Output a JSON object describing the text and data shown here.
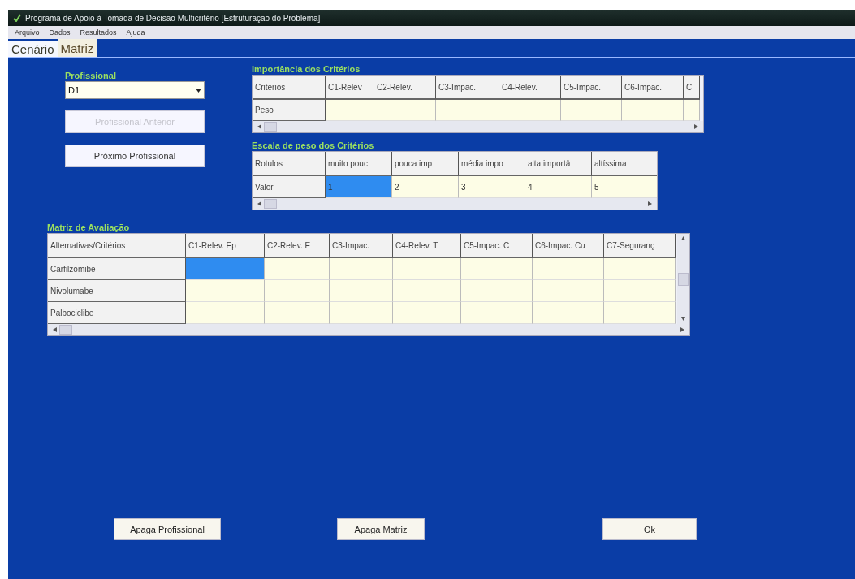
{
  "window": {
    "title": "Programa de Apoio à Tomada de Decisão Multicritério [Estruturação do Problema]"
  },
  "menu": [
    "Arquivo",
    "Dados",
    "Resultados",
    "Ajuda"
  ],
  "tabs": [
    {
      "label": "Cenário",
      "selected": false
    },
    {
      "label": "Matriz",
      "selected": true
    }
  ],
  "professional": {
    "label": "Profissional",
    "value": "D1"
  },
  "side_buttons": [
    {
      "label": "Profissional Anterior",
      "disabled": true
    },
    {
      "label": "Próximo Profissional",
      "disabled": false
    }
  ],
  "importance": {
    "title": "Importância dos Critérios",
    "columns": [
      "Criterios",
      "C1-Relev",
      "C2-Relev.",
      "C3-Impac.",
      "C4-Relev.",
      "C5-Impac.",
      "C6-Impac.",
      "C"
    ],
    "rows": [
      {
        "cells": [
          {
            "text": "Peso",
            "selected": false
          },
          {
            "selected": false
          },
          {
            "selected": false
          },
          {
            "selected": false
          },
          {
            "selected": false
          },
          {
            "selected": false
          },
          {
            "selected": false
          },
          {
            "selected": false
          }
        ]
      }
    ]
  },
  "scale": {
    "title": "Escala de peso dos Critérios",
    "columns": [
      "Rotulos",
      "muito pouc",
      "pouca imp",
      "média impo",
      "alta importâ",
      "altíssima"
    ],
    "rows": [
      {
        "cells": [
          {
            "text": "Valor",
            "selected": false
          },
          {
            "text": "1",
            "selected": true
          },
          {
            "text": "2",
            "selected": false
          },
          {
            "text": "3",
            "selected": false
          },
          {
            "text": "4",
            "selected": false
          },
          {
            "text": "5",
            "selected": false
          }
        ]
      }
    ]
  },
  "matrix": {
    "title": "Matriz de Avaliação",
    "columns": [
      "Alternativas/Critérios",
      "C1-Relev. Ep",
      "C2-Relev. E",
      "C3-Impac.",
      "C4-Relev. T",
      "C5-Impac. C",
      "C6-Impac. Cu",
      "C7-Seguranç"
    ],
    "rows": [
      {
        "cells": [
          {
            "text": "Carfilzomibe",
            "selected": false
          },
          {
            "selected": true
          },
          {
            "selected": false
          },
          {
            "selected": false
          },
          {
            "selected": false
          },
          {
            "selected": false
          },
          {
            "selected": false
          },
          {
            "selected": false
          }
        ]
      },
      {
        "cells": [
          {
            "text": "Nivolumabe",
            "selected": false
          },
          {
            "selected": false
          },
          {
            "selected": false
          },
          {
            "selected": false
          },
          {
            "selected": false
          },
          {
            "selected": false
          },
          {
            "selected": false
          },
          {
            "selected": false
          }
        ]
      },
      {
        "cells": [
          {
            "text": "Palbociclibe",
            "selected": false
          },
          {
            "selected": false
          },
          {
            "selected": false
          },
          {
            "selected": false
          },
          {
            "selected": false
          },
          {
            "selected": false
          },
          {
            "selected": false
          },
          {
            "selected": false
          }
        ]
      }
    ]
  },
  "bottom_buttons": [
    "Apaga Profissional",
    "Apaga Matriz",
    "Ok"
  ]
}
